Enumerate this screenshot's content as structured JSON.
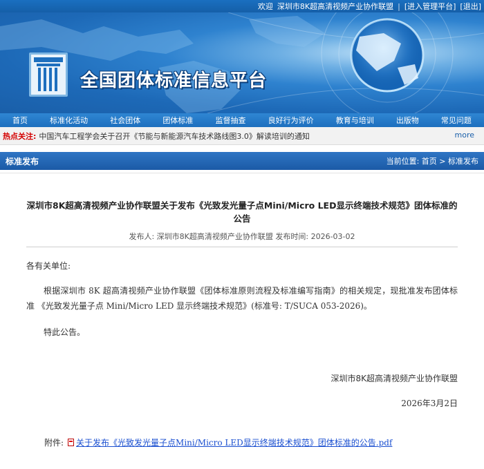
{
  "topbar": {
    "welcome": "欢迎",
    "user": "深圳市8K超高清视频产业协作联盟",
    "admin_link": "[进入管理平台]",
    "logout_link": "[退出]"
  },
  "banner": {
    "site_title": "全国团体标准信息平台"
  },
  "nav": {
    "items": [
      "首页",
      "标准化活动",
      "社会团体",
      "团体标准",
      "监督抽查",
      "良好行为评价",
      "教育与培训",
      "出版物",
      "常见问题"
    ]
  },
  "hot": {
    "label": "热点关注:",
    "text": "中国汽车工程学会关于召开《节能与新能源汽车技术路线图3.0》解读培训的通知",
    "more": "more"
  },
  "section": {
    "title": "标准发布",
    "breadcrumb": "当前位置: 首页 > 标准发布"
  },
  "article": {
    "title": "深圳市8K超高清视频产业协作联盟关于发布《光致发光量子点Mini/Micro LED显示终端技术规范》团体标准的公告",
    "meta": "发布人: 深圳市8K超高清视频产业协作联盟   发布时间: 2026-03-02",
    "greeting": "各有关单位:",
    "body": "根据深圳市 8K 超高清视频产业协作联盟《团体标准原则流程及标准编写指南》的相关规定，现批准发布团体标准 《光致发光量子点 Mini/Micro LED 显示终端技术规范》(标准号: T/SUCA 053-2026)。",
    "closing": "特此公告。",
    "signature": "深圳市8K超高清视频产业协作联盟",
    "date": "2026年3月2日",
    "attachment_label": "附件:",
    "attachment_link": "关于发布《光致发光量子点Mini/Micro LED显示终端技术规范》团体标准的公告.pdf"
  }
}
